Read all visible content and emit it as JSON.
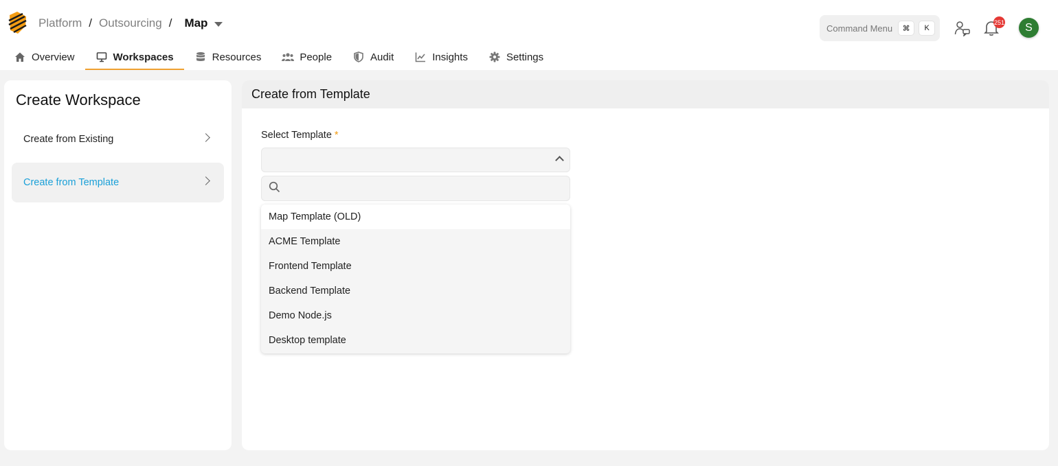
{
  "breadcrumb": {
    "org": "Platform",
    "team": "Outsourcing",
    "project": "Map",
    "separator": "/"
  },
  "command_menu": {
    "label": "Command Menu",
    "key1": "⌘",
    "key2": "K"
  },
  "notifications": {
    "count": "251"
  },
  "user": {
    "initial": "S",
    "avatar_color": "#2e7d32"
  },
  "nav": {
    "tabs": [
      {
        "label": "Overview",
        "icon": "home-icon"
      },
      {
        "label": "Workspaces",
        "icon": "monitor-icon"
      },
      {
        "label": "Resources",
        "icon": "database-icon"
      },
      {
        "label": "People",
        "icon": "people-icon"
      },
      {
        "label": "Audit",
        "icon": "shield-icon"
      },
      {
        "label": "Insights",
        "icon": "chart-line-icon"
      },
      {
        "label": "Settings",
        "icon": "gear-icon"
      }
    ],
    "active": "Workspaces"
  },
  "sidebar": {
    "title": "Create Workspace",
    "items": [
      {
        "label": "Create from Existing"
      },
      {
        "label": "Create from Template"
      }
    ],
    "active": "Create from Template"
  },
  "main": {
    "title": "Create from Template",
    "field_label": "Select Template",
    "required_mark": "*",
    "search_placeholder": "",
    "options": [
      "Map Template (OLD)",
      "ACME Template",
      "Frontend Template",
      "Backend Template",
      "Demo Node.js",
      "Desktop template"
    ]
  },
  "colors": {
    "accent": "#f0a030",
    "link": "#1aa0d8",
    "badge": "#e53935"
  }
}
